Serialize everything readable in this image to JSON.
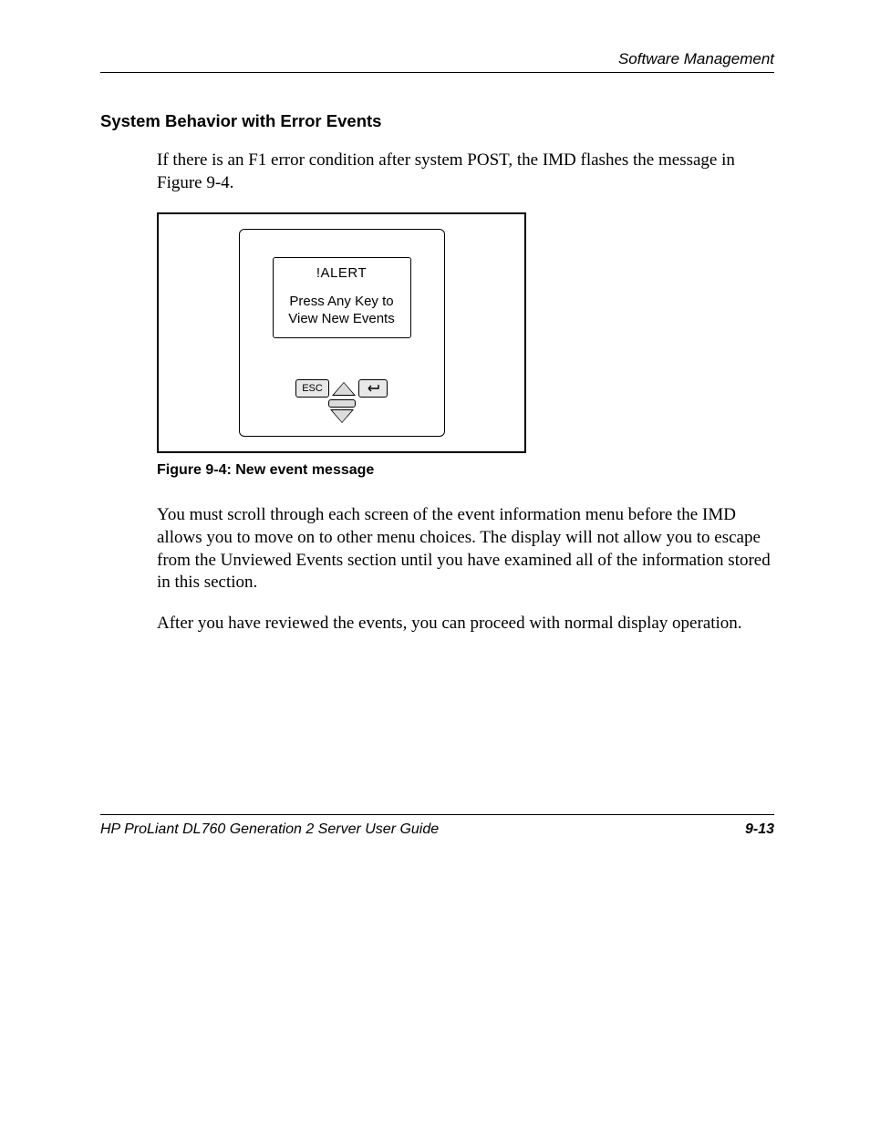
{
  "header": {
    "running_title": "Software Management"
  },
  "section": {
    "heading": "System Behavior with Error Events",
    "para1": "If there is an F1 error condition after system POST, the IMD flashes the message in Figure 9-4.",
    "para2": "You must scroll through each screen of the event information menu before the IMD allows you to move on to other menu choices. The display will not allow you to escape from the Unviewed Events section until you have examined all of the information stored in this section.",
    "para3": "After you have reviewed the events, you can proceed with normal display operation."
  },
  "figure": {
    "caption": "Figure 9-4:  New event message",
    "screen": {
      "alert_line": "!ALERT",
      "msg_line1": "Press Any Key to",
      "msg_line2": "View New Events"
    },
    "buttons": {
      "esc_label": "ESC",
      "enter_glyph": "↵"
    }
  },
  "footer": {
    "doc_title": "HP ProLiant DL760 Generation 2 Server User Guide",
    "page_number": "9-13"
  }
}
